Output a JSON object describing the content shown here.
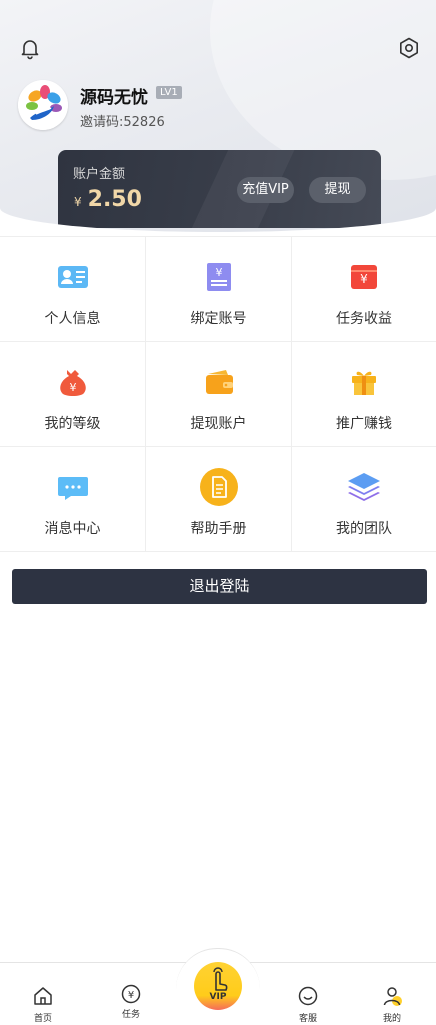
{
  "profile": {
    "username": "源码无忧",
    "level": "LV1",
    "invite_code": "邀请码:52826"
  },
  "balance": {
    "label": "账户金额",
    "currency": "¥",
    "amount": "2.50",
    "recharge_label": "充值VIP",
    "withdraw_label": "提现"
  },
  "menu": {
    "items": [
      {
        "label": "个人信息",
        "icon": "id-card-icon"
      },
      {
        "label": "绑定账号",
        "icon": "bind-account-icon"
      },
      {
        "label": "任务收益",
        "icon": "task-income-icon"
      },
      {
        "label": "我的等级",
        "icon": "money-bag-icon"
      },
      {
        "label": "提现账户",
        "icon": "wallet-icon"
      },
      {
        "label": "推广赚钱",
        "icon": "gift-icon"
      },
      {
        "label": "消息中心",
        "icon": "message-icon"
      },
      {
        "label": "帮助手册",
        "icon": "document-icon"
      },
      {
        "label": "我的团队",
        "icon": "layers-icon"
      }
    ]
  },
  "logout_label": "退出登陆",
  "tabbar": {
    "items": [
      {
        "label": "首页",
        "icon": "home-icon"
      },
      {
        "label": "任务",
        "icon": "task-yen-icon"
      },
      {
        "label": "VIP",
        "icon": "tap-hand-icon"
      },
      {
        "label": "客服",
        "icon": "service-smile-icon"
      },
      {
        "label": "我的",
        "icon": "person-icon"
      }
    ]
  },
  "colors": {
    "header_bg": "#e9ebf0",
    "card_bg": "#2f3440",
    "balance_text": "#f1d7a8",
    "logout_bg": "#2d3342",
    "vip_yellow": "#ffcc1a"
  }
}
